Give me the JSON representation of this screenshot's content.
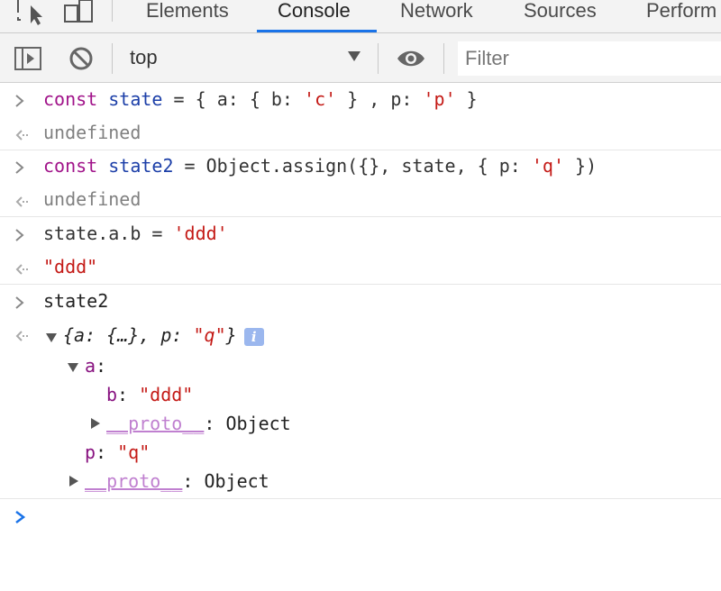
{
  "tabs": [
    {
      "label": "Elements"
    },
    {
      "label": "Console"
    },
    {
      "label": "Network"
    },
    {
      "label": "Sources"
    },
    {
      "label": "Perform"
    }
  ],
  "toolbar": {
    "context": "top",
    "filter_placeholder": "Filter"
  },
  "console": {
    "entry1": {
      "t1": "const",
      "t2": " ",
      "t3": "state",
      "t4": " = { a: { b: ",
      "t5": "'c'",
      "t6": " } , p: ",
      "t7": "'p'",
      "t8": " }",
      "result": "undefined"
    },
    "entry2": {
      "t1": "const",
      "t2": " ",
      "t3": "state2",
      "t4": " = Object.assign({}, state, { p: ",
      "t5": "'q'",
      "t6": " })",
      "result": "undefined"
    },
    "entry3": {
      "t1": "state.a.b = ",
      "t2": "'ddd'",
      "result": "\"ddd\""
    },
    "entry4": {
      "input": "state2",
      "preview": {
        "p1": "{a: {…}, p: ",
        "p2": "\"q\"",
        "p3": "}",
        "info": "i"
      },
      "tree": {
        "a_key": "a",
        "a_colon": ":",
        "b_key": "b",
        "b_colon": ": ",
        "b_value": "\"ddd\"",
        "proto_inner_key": "__proto__",
        "proto_inner_sep": ": ",
        "proto_inner_value": "Object",
        "p_key": "p",
        "p_colon": ": ",
        "p_value": "\"q\"",
        "proto_outer_key": "__proto__",
        "proto_outer_sep": ": ",
        "proto_outer_value": "Object"
      }
    }
  },
  "colors": {
    "keyword": "#a1148a",
    "identifier": "#1c3fa8",
    "string": "#c41a16",
    "property": "#881280",
    "proto": "#c080d0",
    "muted": "#808080",
    "prompt": "#1a73e8",
    "active_tab_underline": "#1a73e8"
  },
  "icons": [
    "inspect-element-icon",
    "device-toggle-icon",
    "sidebar-toggle-icon",
    "clear-console-icon",
    "dropdown-arrow-icon",
    "eye-icon",
    "info-icon",
    "expand-arrow-icon",
    "collapse-arrow-icon",
    "prompt-icon",
    "input-chevron-icon",
    "result-arrow-icon"
  ]
}
